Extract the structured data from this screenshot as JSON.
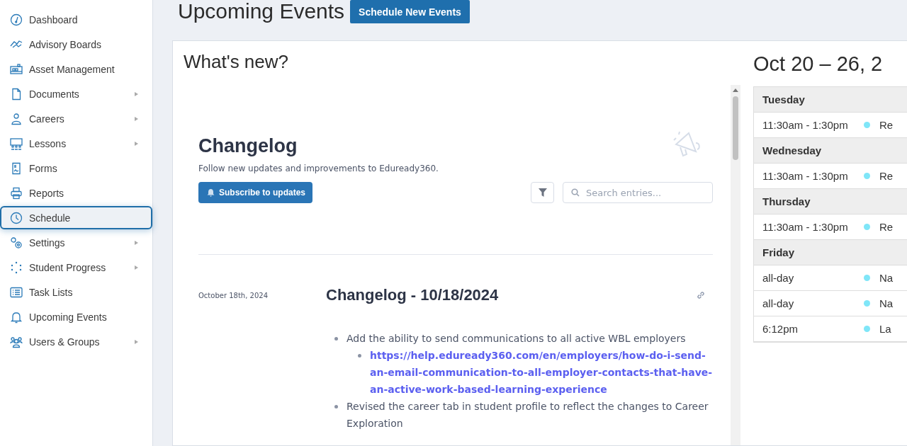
{
  "sidebar": {
    "items": [
      {
        "label": "Dashboard",
        "selected": false,
        "expandable": false
      },
      {
        "label": "Advisory Boards",
        "selected": false,
        "expandable": false
      },
      {
        "label": "Asset Management",
        "selected": false,
        "expandable": false
      },
      {
        "label": "Documents",
        "selected": false,
        "expandable": true
      },
      {
        "label": "Careers",
        "selected": false,
        "expandable": true
      },
      {
        "label": "Lessons",
        "selected": false,
        "expandable": true
      },
      {
        "label": "Forms",
        "selected": false,
        "expandable": false
      },
      {
        "label": "Reports",
        "selected": false,
        "expandable": false
      },
      {
        "label": "Schedule",
        "selected": true,
        "expandable": false
      },
      {
        "label": "Settings",
        "selected": false,
        "expandable": true
      },
      {
        "label": "Student Progress",
        "selected": false,
        "expandable": true
      },
      {
        "label": "Task Lists",
        "selected": false,
        "expandable": false
      },
      {
        "label": "Upcoming Events",
        "selected": false,
        "expandable": false
      },
      {
        "label": "Users & Groups",
        "selected": false,
        "expandable": true
      }
    ]
  },
  "header": {
    "title": "Upcoming Events",
    "button": "Schedule New Events"
  },
  "whats_new": {
    "title": "What's new?",
    "changelog": {
      "title": "Changelog",
      "subtitle": "Follow new updates and improvements to Eduready360.",
      "subscribe_button": "Subscribe to updates",
      "search": {
        "placeholder": "Search entries..."
      },
      "entries": [
        {
          "date": "October 18th, 2024",
          "title": "Changelog - 10/18/2024",
          "items": [
            {
              "text": "Add the ability to send communications to all active WBL employers",
              "children": [
                {
                  "link": "https://help.eduready360.com/en/employers/how-do-i-send-an-email-communication-to-all-employer-contacts-that-have-an-active-work-based-learning-experience"
                }
              ]
            },
            {
              "text": "Revised the career tab in student profile to reflect the changes to Career Exploration"
            }
          ]
        }
      ]
    }
  },
  "calendar": {
    "title": "Oct 20 – 26, 2",
    "days": [
      {
        "day": "Tuesday",
        "events": [
          {
            "time": "11:30am - 1:30pm",
            "title": "Re",
            "color": "#7fe6f8"
          }
        ]
      },
      {
        "day": "Wednesday",
        "events": [
          {
            "time": "11:30am - 1:30pm",
            "title": "Re",
            "color": "#7fe6f8"
          }
        ]
      },
      {
        "day": "Thursday",
        "events": [
          {
            "time": "11:30am - 1:30pm",
            "title": "Re",
            "color": "#7fe6f8"
          }
        ]
      },
      {
        "day": "Friday",
        "events": [
          {
            "time": "all-day",
            "title": "Na",
            "color": "#7fe6f8"
          },
          {
            "time": "all-day",
            "title": "Na",
            "color": "#7fe6f8"
          },
          {
            "time": "6:12pm",
            "title": "La",
            "color": "#7fe6f8"
          }
        ]
      }
    ]
  }
}
